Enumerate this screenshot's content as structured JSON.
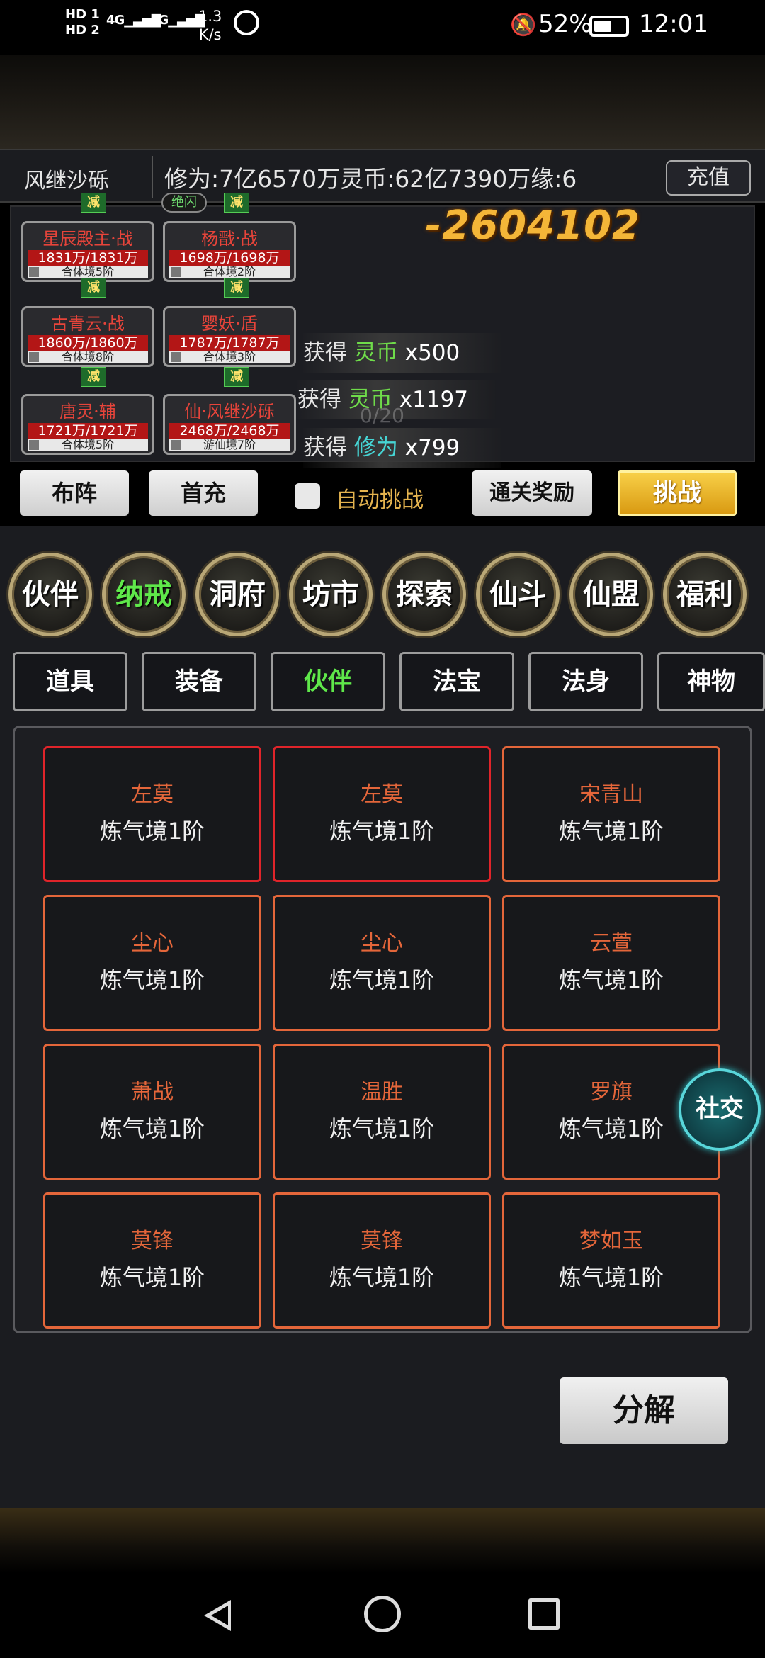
{
  "status_bar": {
    "net1": "HD 1",
    "net2": "HD 2",
    "signal1": "4G",
    "signal2": "4G",
    "speed_value": "1.3",
    "speed_unit": "K/s",
    "battery": "52%",
    "time": "12:01"
  },
  "header": {
    "player_name": "风继沙砾",
    "resources_text": "修为:7亿6570万灵币:62亿7390万缘:6",
    "recharge_label": "充值"
  },
  "battle": {
    "damage": "-2604102",
    "buff_tag": "绝闪",
    "buff_label": "减",
    "units": [
      {
        "name": "星辰殿主·战",
        "hp": "1831万/1831万",
        "rank": "合体境5阶"
      },
      {
        "name": "杨戬·战",
        "hp": "1698万/1698万",
        "rank": "合体境2阶"
      },
      {
        "name": "古青云·战",
        "hp": "1860万/1860万",
        "rank": "合体境8阶"
      },
      {
        "name": "婴妖·盾",
        "hp": "1787万/1787万",
        "rank": "合体境3阶"
      },
      {
        "name": "唐灵·辅",
        "hp": "1721万/1721万",
        "rank": "合体境5阶"
      },
      {
        "name": "仙·风继沙砾",
        "hp": "2468万/2468万",
        "rank": "游仙境7阶"
      }
    ],
    "loot": [
      {
        "label": "获得",
        "item": "灵币",
        "amount": "x500"
      },
      {
        "label": "获得",
        "item": "灵币",
        "amount": "x1197"
      },
      {
        "label": "获得",
        "item": "修为",
        "amount": "x799"
      }
    ],
    "progress_ghost": "0/20",
    "formation_label": "布阵",
    "first_charge_label": "首充",
    "auto_challenge_label": "自动挑战",
    "clear_reward_label": "通关奖励",
    "challenge_label": "挑战"
  },
  "nav": [
    "伙伴",
    "纳戒",
    "洞府",
    "坊市",
    "探索",
    "仙斗",
    "仙盟",
    "福利"
  ],
  "nav_active": "纳戒",
  "tabs": [
    "道具",
    "装备",
    "伙伴",
    "法宝",
    "法身",
    "神物"
  ],
  "tabs_active": "伙伴",
  "cards": [
    {
      "name": "左莫",
      "level": "炼气境1阶"
    },
    {
      "name": "左莫",
      "level": "炼气境1阶"
    },
    {
      "name": "宋青山",
      "level": "炼气境1阶"
    },
    {
      "name": "尘心",
      "level": "炼气境1阶"
    },
    {
      "name": "尘心",
      "level": "炼气境1阶"
    },
    {
      "name": "云萱",
      "level": "炼气境1阶"
    },
    {
      "name": "萧战",
      "level": "炼气境1阶"
    },
    {
      "name": "温胜",
      "level": "炼气境1阶"
    },
    {
      "name": "罗旗",
      "level": "炼气境1阶"
    },
    {
      "name": "莫锋",
      "level": "炼气境1阶"
    },
    {
      "name": "莫锋",
      "level": "炼气境1阶"
    },
    {
      "name": "梦如玉",
      "level": "炼气境1阶"
    }
  ],
  "social_label": "社交",
  "decompose_label": "分解",
  "colors": {
    "active_green": "#5fe84a",
    "card_border": "#e4663a",
    "card_selected": "#e0242a",
    "damage_gold": "#f4b638"
  }
}
